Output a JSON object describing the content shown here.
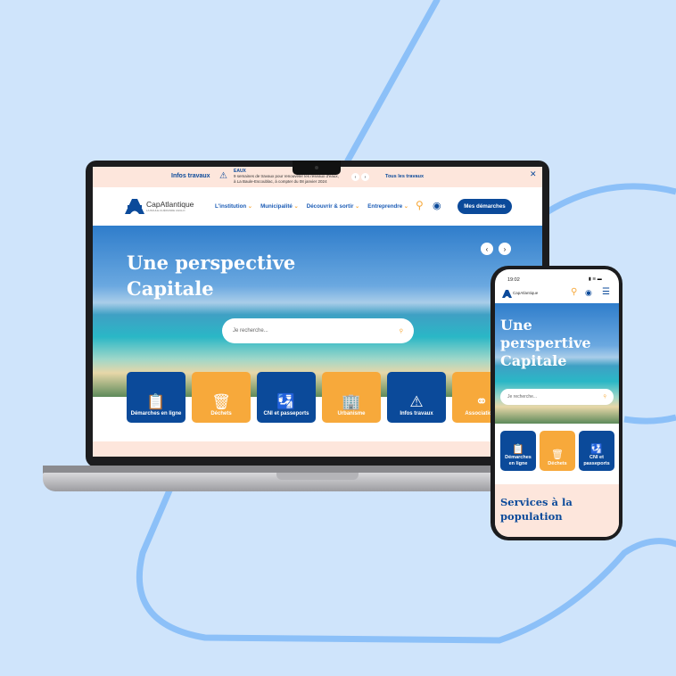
{
  "colors": {
    "primary": "#0b4a9a",
    "accent": "#f7a93b",
    "banner": "#fde6dc",
    "background": "#cfe4fb"
  },
  "laptop": {
    "banner": {
      "label": "Infos travaux",
      "category": "EAUX",
      "message": "9 semaines de travaux pour renouveler les réseaux d'eaux, à La Baule-Escoublac, à compter du 08 janvier 2024",
      "all_link": "Tous les travaux",
      "icon": "roadwork-icon"
    },
    "header": {
      "logo": "CapAtlantique",
      "logo_sub": "LA BAULE-GUÉRANDE AGGLO",
      "nav": [
        "L'institution",
        "Municipalité",
        "Découvrir & sortir",
        "Entreprendre"
      ],
      "cta": "Mes démarches"
    },
    "hero": {
      "title_line1": "Une perspective",
      "title_line2": "Capitale",
      "search_placeholder": "Je recherche..."
    },
    "tiles": [
      {
        "label": "Démarches en ligne",
        "icon": "clipboard-icon",
        "color": "blue"
      },
      {
        "label": "Déchets",
        "icon": "trash-icon",
        "color": "orange"
      },
      {
        "label": "CNI et passeports",
        "icon": "passport-icon",
        "color": "blue"
      },
      {
        "label": "Urbanisme",
        "icon": "building-icon",
        "color": "orange"
      },
      {
        "label": "Infos travaux",
        "icon": "roadwork-icon",
        "color": "blue"
      },
      {
        "label": "Associations",
        "icon": "network-icon",
        "color": "orange"
      }
    ]
  },
  "phone": {
    "time": "19:02",
    "logo": "CapAtlantique",
    "hero_title": [
      "Une",
      "perspertive",
      "Capitale"
    ],
    "search_placeholder": "Je recherche...",
    "tiles": [
      {
        "label": "Démarches en ligne"
      },
      {
        "label": "Déchets"
      },
      {
        "label": "CNI et passeports"
      }
    ],
    "section_title": "Services à la population"
  }
}
